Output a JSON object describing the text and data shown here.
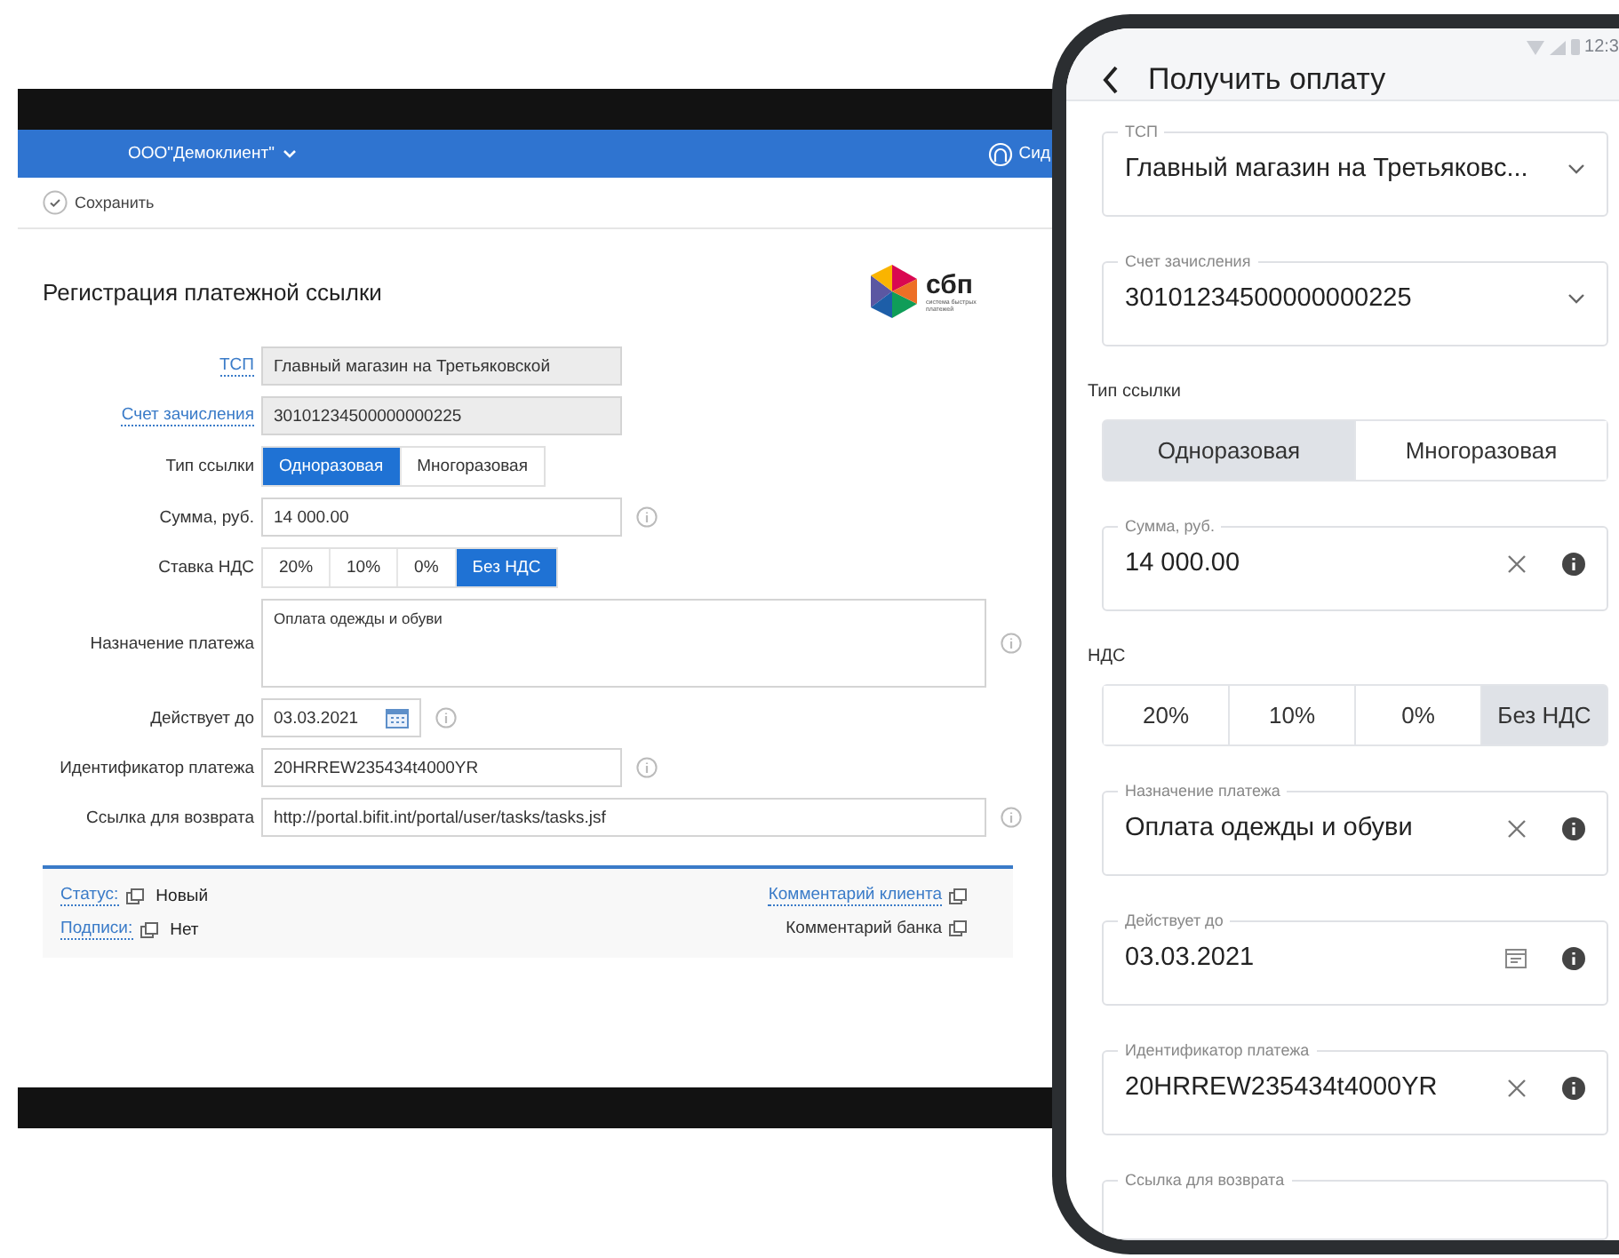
{
  "desktop": {
    "org_menu": "ООО\"Демоклиент\"",
    "user_name": "Сид",
    "save": "Сохранить",
    "title": "Регистрация платежной ссылки",
    "logo": {
      "name": "сбп",
      "tagline": "система быстрых платежей"
    },
    "fields": [
      {
        "kind": "readonly",
        "label": "ТСП",
        "label_link": true,
        "value": "Главный магазин на Третьяковской",
        "info": false
      },
      {
        "kind": "readonly",
        "label": "Счет зачисления",
        "label_link": true,
        "value": "30101234500000000225",
        "info": false
      },
      {
        "kind": "segmented",
        "label": "Тип ссылки",
        "label_link": false,
        "info": false,
        "options": [
          {
            "label": "Одноразовая",
            "selected": true
          },
          {
            "label": "Многоразовая",
            "selected": false
          }
        ]
      },
      {
        "kind": "input",
        "label": "Сумма, руб.",
        "label_link": false,
        "value": "14 000.00",
        "info": true
      },
      {
        "kind": "segmented",
        "label": "Ставка НДС",
        "label_link": false,
        "info": false,
        "options": [
          {
            "label": "20%",
            "selected": false
          },
          {
            "label": "10%",
            "selected": false
          },
          {
            "label": "0%",
            "selected": false
          },
          {
            "label": "Без НДС",
            "selected": true
          }
        ]
      },
      {
        "kind": "textarea",
        "label": "Назначение платежа",
        "label_link": false,
        "value": "Оплата одежды и обуви",
        "info": true
      },
      {
        "kind": "date",
        "label": "Действует до",
        "label_link": false,
        "value": "03.03.2021",
        "info": true
      },
      {
        "kind": "input",
        "label": "Идентификатор платежа",
        "label_link": false,
        "value": "20HRREW235434t4000YR",
        "info": true
      },
      {
        "kind": "wide_input",
        "label": "Ссылка для возврата",
        "label_link": false,
        "value": "http://portal.bifit.int/portal/user/tasks/tasks.jsf",
        "info": true
      }
    ],
    "footer": {
      "left": [
        {
          "label": "Статус:",
          "value": "Новый"
        },
        {
          "label": "Подписи:",
          "value": "Нет"
        }
      ],
      "right": [
        {
          "label": "Комментарий клиента",
          "link": true
        },
        {
          "label": "Комментарий банка",
          "link": false
        }
      ]
    }
  },
  "phone": {
    "status_time": "12:3",
    "title": "Получить оплату",
    "items": [
      {
        "kind": "select",
        "label": "ТСП",
        "value": "Главный магазин на Третьяковс..."
      },
      {
        "kind": "select",
        "label": "Счет зачисления",
        "value": "30101234500000000225"
      },
      {
        "kind": "segmented",
        "label": "Тип ссылки",
        "options": [
          {
            "label": "Одноразовая",
            "selected": true
          },
          {
            "label": "Многоразовая",
            "selected": false
          }
        ]
      },
      {
        "kind": "input",
        "label": "Сумма, руб.",
        "value": "14 000.00"
      },
      {
        "kind": "segmented",
        "label": "НДС",
        "options": [
          {
            "label": "20%",
            "selected": false
          },
          {
            "label": "10%",
            "selected": false
          },
          {
            "label": "0%",
            "selected": false
          },
          {
            "label": "Без НДС",
            "selected": true
          }
        ]
      },
      {
        "kind": "input",
        "label": "Назначение платежа",
        "value": "Оплата одежды и обуви"
      },
      {
        "kind": "date",
        "label": "Действует до",
        "value": "03.03.2021"
      },
      {
        "kind": "input",
        "label": "Идентификатор платежа",
        "value": "20HRREW235434t4000YR"
      },
      {
        "kind": "partial",
        "label": "Ссылка для возврата"
      }
    ]
  }
}
